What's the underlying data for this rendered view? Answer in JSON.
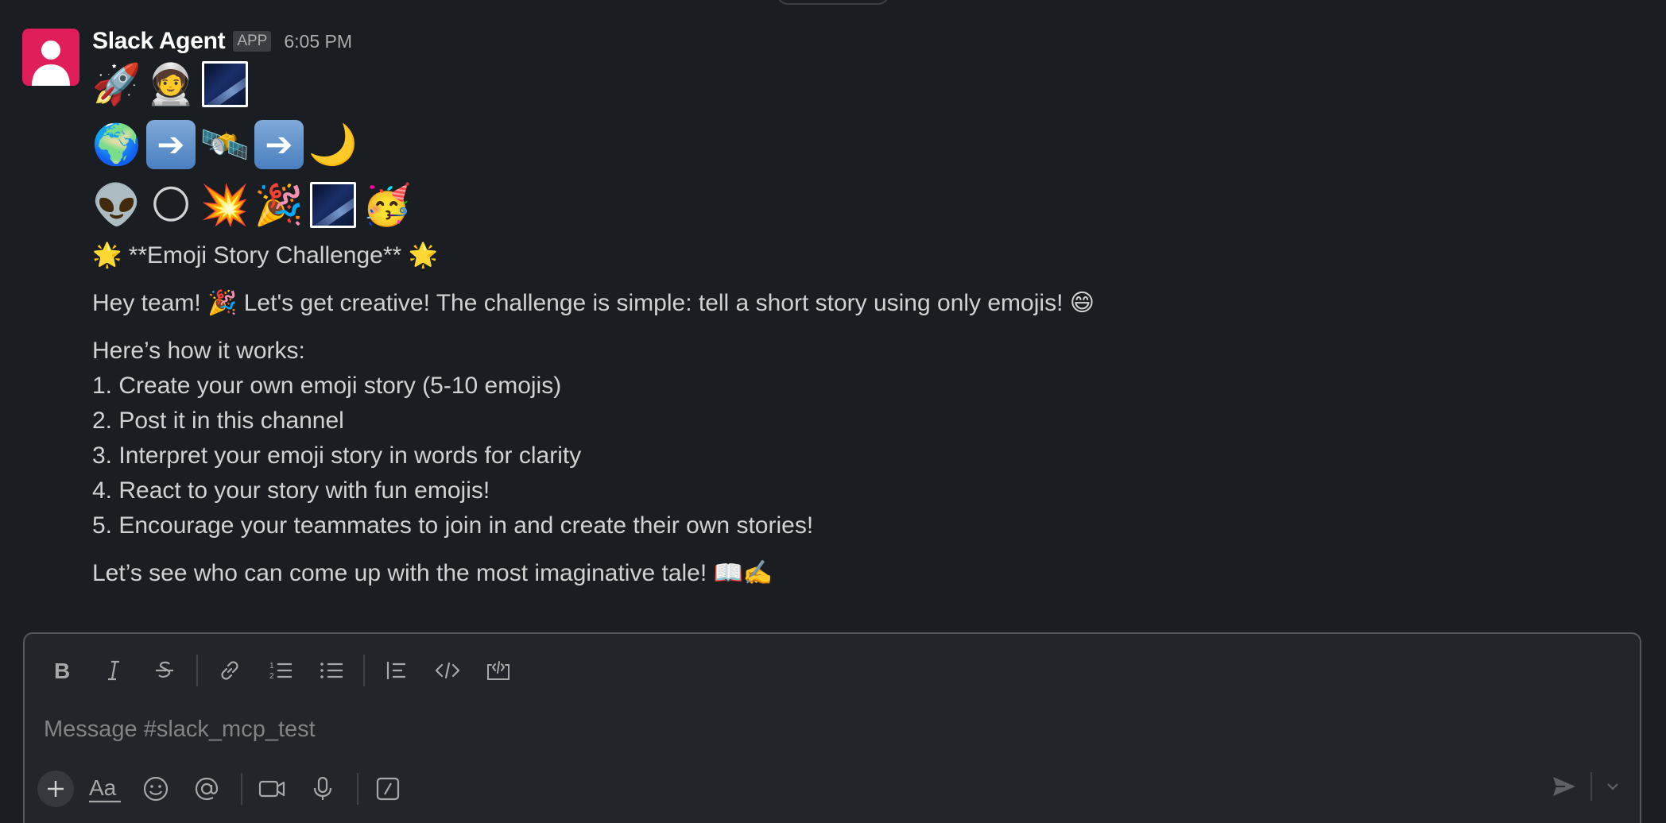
{
  "message": {
    "sender": "Slack Agent",
    "badge": "APP",
    "time": "6:05 PM",
    "emoji_rows": [
      [
        "🚀",
        "🧑‍🚀",
        "[milky-way]"
      ],
      [
        "🌍",
        "➡️",
        "🛰️",
        "➡️",
        "🌙"
      ],
      [
        "👽",
        "🌕",
        "💥",
        "🎉",
        "[milky-way]",
        "🥳"
      ]
    ],
    "heading": "🌟 **Emoji Story Challenge** 🌟",
    "intro": "Hey team! 🎉 Let's get creative! The challenge is simple: tell a short story using only emojis! 😄",
    "how_title": "Here’s how it works:",
    "steps": [
      "1. Create your own emoji story (5-10 emojis)",
      "2. Post it in this channel",
      "3. Interpret your emoji story in words for clarity",
      "4. React to your story with fun emojis!",
      "5. Encourage your teammates to join in and create their own stories!"
    ],
    "closing": "Let’s see who can come up with the most imaginative tale! 📖✍️"
  },
  "composer": {
    "placeholder": "Message #slack_mcp_test",
    "toolbar_icons": [
      "bold-icon",
      "italic-icon",
      "strikethrough-icon",
      "link-icon",
      "numbered-list-icon",
      "bulleted-list-icon",
      "blockquote-icon",
      "code-icon",
      "code-block-icon"
    ],
    "bottom_icons": [
      "plus-icon",
      "formatting-icon",
      "emoji-icon",
      "mention-icon",
      "video-icon",
      "microphone-icon",
      "slash-command-icon",
      "send-icon",
      "chevron-down-icon"
    ]
  },
  "colors": {
    "background": "#1a1d21",
    "avatar": "#e01e5a",
    "text": "#d1d2d3",
    "muted": "#abacad"
  }
}
